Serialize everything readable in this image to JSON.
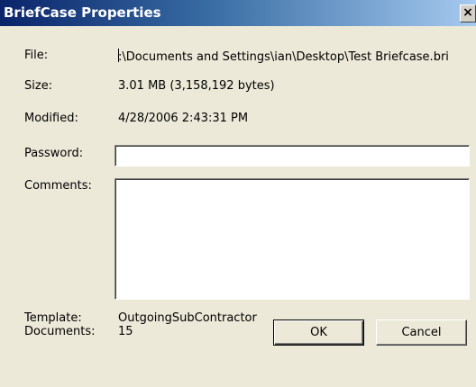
{
  "window": {
    "title": "BriefCase Properties",
    "close_glyph": "×",
    "close_icon": "close-icon"
  },
  "fields": {
    "file_label": "File:",
    "file_value": ":\\Documents and Settings\\ian\\Desktop\\Test Briefcase.bri",
    "size_label": "Size:",
    "size_value": "3.01 MB (3,158,192 bytes)",
    "modified_label": "Modified:",
    "modified_value": "4/28/2006 2:43:31 PM",
    "password_label": "Password:",
    "password_value": "",
    "comments_label": "Comments:",
    "comments_value": "",
    "template_label": "Template:",
    "template_value": "OutgoingSubContractor",
    "documents_label": "Documents:",
    "documents_value": "15"
  },
  "buttons": {
    "ok_label": "OK",
    "cancel_label": "Cancel"
  },
  "colors": {
    "titlebar_start": "#0a246a",
    "titlebar_end": "#a6caf0",
    "dialog_background": "#ece9d8"
  }
}
